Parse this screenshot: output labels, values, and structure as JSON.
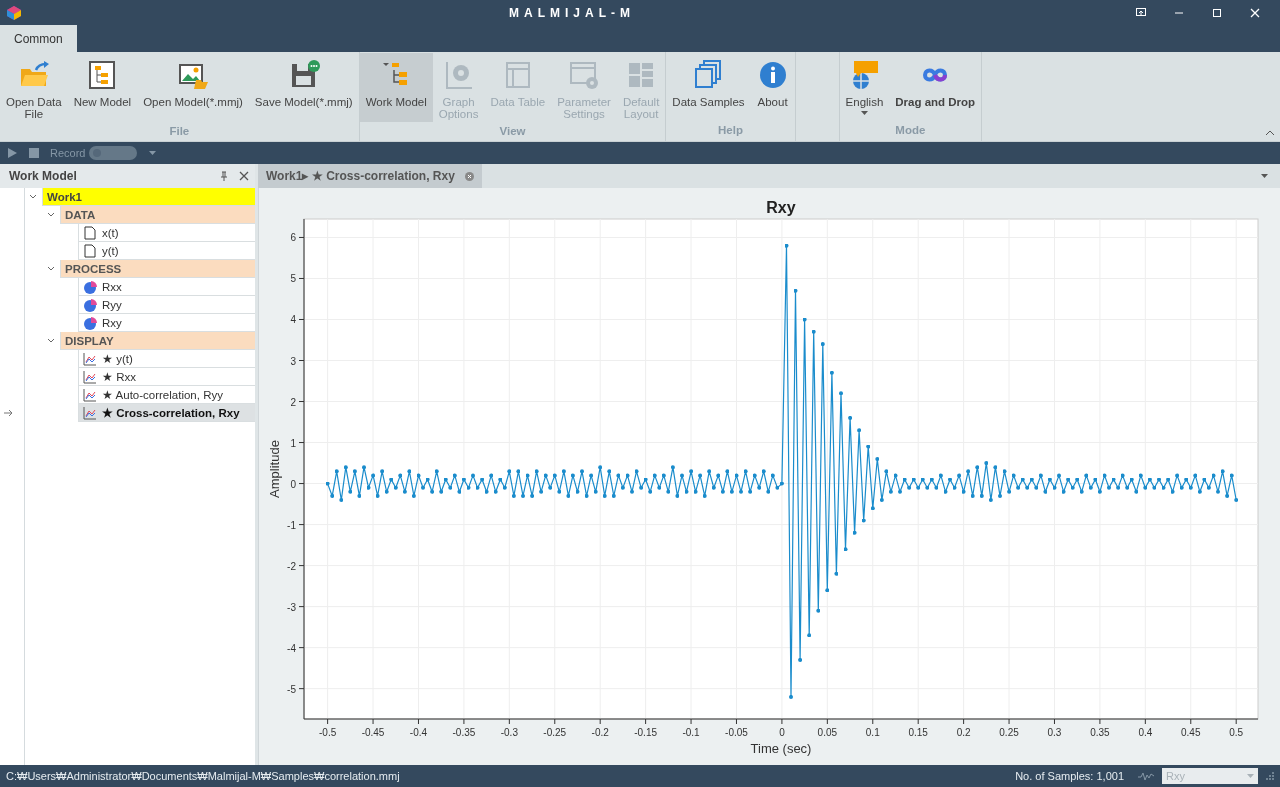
{
  "window": {
    "title": "MALMIJAL-M"
  },
  "ribbon_tabs": [
    {
      "label": "Common",
      "selected": true
    }
  ],
  "ribbon": {
    "groups": [
      {
        "label": "File",
        "buttons": [
          {
            "label": "Open Data\nFile",
            "disabled": false,
            "selected": false,
            "bold": false,
            "dropdown": false
          },
          {
            "label": "New Model",
            "disabled": false,
            "selected": false,
            "bold": false,
            "dropdown": false
          },
          {
            "label": "Open Model(*.mmj)",
            "disabled": false,
            "selected": false,
            "bold": false,
            "dropdown": false
          },
          {
            "label": "Save Model(*.mmj)",
            "disabled": false,
            "selected": false,
            "bold": false,
            "dropdown": false
          }
        ]
      },
      {
        "label": "View",
        "buttons": [
          {
            "label": "Work Model",
            "disabled": false,
            "selected": true,
            "bold": false,
            "dropdown": false
          },
          {
            "label": "Graph\nOptions",
            "disabled": true,
            "selected": false,
            "bold": false,
            "dropdown": false
          },
          {
            "label": "Data Table",
            "disabled": true,
            "selected": false,
            "bold": false,
            "dropdown": false
          },
          {
            "label": "Parameter\nSettings",
            "disabled": true,
            "selected": false,
            "bold": false,
            "dropdown": false
          },
          {
            "label": "Default\nLayout",
            "disabled": true,
            "selected": false,
            "bold": false,
            "dropdown": false
          }
        ]
      },
      {
        "label": "Help",
        "buttons": [
          {
            "label": "Data Samples",
            "disabled": false,
            "selected": false,
            "bold": false,
            "dropdown": false
          },
          {
            "label": "About",
            "disabled": false,
            "selected": false,
            "bold": false,
            "dropdown": false
          }
        ]
      },
      {
        "label": "Mode",
        "buttons": [
          {
            "label": "English",
            "disabled": false,
            "selected": false,
            "bold": false,
            "dropdown": true
          },
          {
            "label": "Drag and Drop",
            "disabled": false,
            "selected": false,
            "bold": true,
            "dropdown": false
          }
        ]
      }
    ]
  },
  "quick_bar": {
    "record_label": "Record",
    "record_on": false
  },
  "work_model_panel": {
    "title": "Work Model",
    "tree": [
      {
        "label": "Work1",
        "kind": "root",
        "expanded": true,
        "selected": false,
        "children": [
          {
            "label": "DATA",
            "kind": "group",
            "expanded": true,
            "selected": false,
            "children": [
              {
                "label": "x(t)",
                "kind": "data",
                "selected": false
              },
              {
                "label": "y(t)",
                "kind": "data",
                "selected": false
              }
            ]
          },
          {
            "label": "PROCESS",
            "kind": "group",
            "expanded": true,
            "selected": false,
            "children": [
              {
                "label": "Rxx",
                "kind": "process",
                "selected": false
              },
              {
                "label": "Ryy",
                "kind": "process",
                "selected": false
              },
              {
                "label": "Rxy",
                "kind": "process",
                "selected": false
              }
            ]
          },
          {
            "label": "DISPLAY",
            "kind": "group",
            "expanded": true,
            "selected": false,
            "children": [
              {
                "label": "★ y(t)",
                "kind": "display",
                "selected": false
              },
              {
                "label": "★ Rxx",
                "kind": "display",
                "selected": false
              },
              {
                "label": "★ Auto-correlation, Ryy",
                "kind": "display",
                "selected": false
              },
              {
                "label": "★ Cross-correlation, Rxy",
                "kind": "display",
                "selected": true
              }
            ]
          }
        ]
      }
    ]
  },
  "document_tabs": [
    {
      "label": "Work1▸ ★ Cross-correlation, Rxy",
      "selected": true
    }
  ],
  "chart": {
    "chart_data": {
      "type": "line",
      "title": "Rxy",
      "xlabel": "Time (sec)",
      "ylabel": "Amplitude",
      "xlim": [
        -0.526,
        0.524
      ],
      "ylim": [
        -5.74,
        6.45
      ],
      "xticks": [
        -0.5,
        -0.45,
        -0.4,
        -0.35,
        -0.3,
        -0.25,
        -0.2,
        -0.15,
        -0.1,
        -0.05,
        0,
        0.05,
        0.1,
        0.15,
        0.2,
        0.25,
        0.3,
        0.35,
        0.4,
        0.45,
        0.5
      ],
      "yticks": [
        -5,
        -4,
        -3,
        -2,
        -1,
        0,
        1,
        2,
        3,
        4,
        5,
        6
      ],
      "x": [
        -0.5,
        -0.495,
        -0.49,
        -0.485,
        -0.48,
        -0.475,
        -0.47,
        -0.465,
        -0.46,
        -0.455,
        -0.45,
        -0.445,
        -0.44,
        -0.435,
        -0.43,
        -0.425,
        -0.42,
        -0.415,
        -0.41,
        -0.405,
        -0.4,
        -0.395,
        -0.39,
        -0.385,
        -0.38,
        -0.375,
        -0.37,
        -0.365,
        -0.36,
        -0.355,
        -0.35,
        -0.345,
        -0.34,
        -0.335,
        -0.33,
        -0.325,
        -0.32,
        -0.315,
        -0.31,
        -0.305,
        -0.3,
        -0.295,
        -0.29,
        -0.285,
        -0.28,
        -0.275,
        -0.27,
        -0.265,
        -0.26,
        -0.255,
        -0.25,
        -0.245,
        -0.24,
        -0.235,
        -0.23,
        -0.225,
        -0.22,
        -0.215,
        -0.21,
        -0.205,
        -0.2,
        -0.195,
        -0.19,
        -0.185,
        -0.18,
        -0.175,
        -0.17,
        -0.165,
        -0.16,
        -0.155,
        -0.15,
        -0.145,
        -0.14,
        -0.135,
        -0.13,
        -0.125,
        -0.12,
        -0.115,
        -0.11,
        -0.105,
        -0.1,
        -0.095,
        -0.09,
        -0.085,
        -0.08,
        -0.075,
        -0.07,
        -0.065,
        -0.06,
        -0.055,
        -0.05,
        -0.045,
        -0.04,
        -0.035,
        -0.03,
        -0.025,
        -0.02,
        -0.015,
        -0.01,
        -0.005,
        0,
        0.005,
        0.01,
        0.015,
        0.02,
        0.025,
        0.03,
        0.035,
        0.04,
        0.045,
        0.05,
        0.055,
        0.06,
        0.065,
        0.07,
        0.075,
        0.08,
        0.085,
        0.09,
        0.095,
        0.1,
        0.105,
        0.11,
        0.115,
        0.12,
        0.125,
        0.13,
        0.135,
        0.14,
        0.145,
        0.15,
        0.155,
        0.16,
        0.165,
        0.17,
        0.175,
        0.18,
        0.185,
        0.19,
        0.195,
        0.2,
        0.205,
        0.21,
        0.215,
        0.22,
        0.225,
        0.23,
        0.235,
        0.24,
        0.245,
        0.25,
        0.255,
        0.26,
        0.265,
        0.27,
        0.275,
        0.28,
        0.285,
        0.29,
        0.295,
        0.3,
        0.305,
        0.31,
        0.315,
        0.32,
        0.325,
        0.33,
        0.335,
        0.34,
        0.345,
        0.35,
        0.355,
        0.36,
        0.365,
        0.37,
        0.375,
        0.38,
        0.385,
        0.39,
        0.395,
        0.4,
        0.405,
        0.41,
        0.415,
        0.42,
        0.425,
        0.43,
        0.435,
        0.44,
        0.445,
        0.45,
        0.455,
        0.46,
        0.465,
        0.47,
        0.475,
        0.48,
        0.485,
        0.49,
        0.495,
        0.5
      ],
      "grid": true,
      "series": [
        {
          "color": "#1a8ccc",
          "values": [
            0.0,
            -0.3,
            0.3,
            -0.4,
            0.4,
            -0.2,
            0.3,
            -0.3,
            0.4,
            -0.1,
            0.2,
            -0.3,
            0.3,
            -0.2,
            0.1,
            -0.1,
            0.2,
            -0.2,
            0.3,
            -0.3,
            0.2,
            -0.1,
            0.1,
            -0.2,
            0.3,
            -0.2,
            0.1,
            -0.1,
            0.2,
            -0.2,
            0.1,
            -0.1,
            0.2,
            -0.1,
            0.1,
            -0.2,
            0.2,
            -0.2,
            0.1,
            -0.1,
            0.3,
            -0.3,
            0.3,
            -0.3,
            0.2,
            -0.3,
            0.3,
            -0.2,
            0.2,
            -0.1,
            0.2,
            -0.2,
            0.3,
            -0.3,
            0.2,
            -0.2,
            0.3,
            -0.3,
            0.2,
            -0.2,
            0.4,
            -0.3,
            0.3,
            -0.3,
            0.2,
            -0.1,
            0.2,
            -0.2,
            0.3,
            -0.1,
            0.1,
            -0.2,
            0.2,
            -0.1,
            0.2,
            -0.2,
            0.4,
            -0.3,
            0.2,
            -0.2,
            0.3,
            -0.2,
            0.2,
            -0.3,
            0.3,
            -0.1,
            0.2,
            -0.2,
            0.3,
            -0.2,
            0.2,
            -0.2,
            0.3,
            -0.2,
            0.2,
            -0.1,
            0.3,
            -0.2,
            0.2,
            -0.1,
            0.0,
            5.8,
            -5.2,
            4.7,
            -4.3,
            4.0,
            -3.7,
            3.7,
            -3.1,
            3.4,
            -2.6,
            2.7,
            -2.2,
            2.2,
            -1.6,
            1.6,
            -1.2,
            1.3,
            -0.9,
            0.9,
            -0.6,
            0.6,
            -0.4,
            0.3,
            -0.2,
            0.2,
            -0.2,
            0.1,
            -0.1,
            0.1,
            -0.1,
            0.1,
            -0.1,
            0.1,
            -0.1,
            0.2,
            -0.2,
            0.1,
            -0.1,
            0.2,
            -0.2,
            0.3,
            -0.3,
            0.4,
            -0.3,
            0.5,
            -0.4,
            0.4,
            -0.3,
            0.3,
            -0.2,
            0.2,
            -0.1,
            0.1,
            -0.1,
            0.1,
            -0.1,
            0.2,
            -0.2,
            0.1,
            -0.1,
            0.2,
            -0.2,
            0.1,
            -0.1,
            0.1,
            -0.2,
            0.2,
            -0.1,
            0.1,
            -0.2,
            0.2,
            -0.1,
            0.1,
            -0.1,
            0.2,
            -0.1,
            0.1,
            -0.2,
            0.2,
            -0.1,
            0.1,
            -0.1,
            0.1,
            -0.1,
            0.1,
            -0.2,
            0.2,
            -0.1,
            0.1,
            -0.1,
            0.2,
            -0.2,
            0.1,
            -0.1,
            0.2,
            -0.2,
            0.3,
            -0.3,
            0.2,
            -0.4
          ]
        }
      ]
    }
  },
  "status_bar": {
    "path": "C:₩Users₩Administrator₩Documents₩Malmijal-M₩Samples₩correlation.mmj",
    "samples": "No. of Samples: 1,001",
    "view_select": "Rxy"
  }
}
